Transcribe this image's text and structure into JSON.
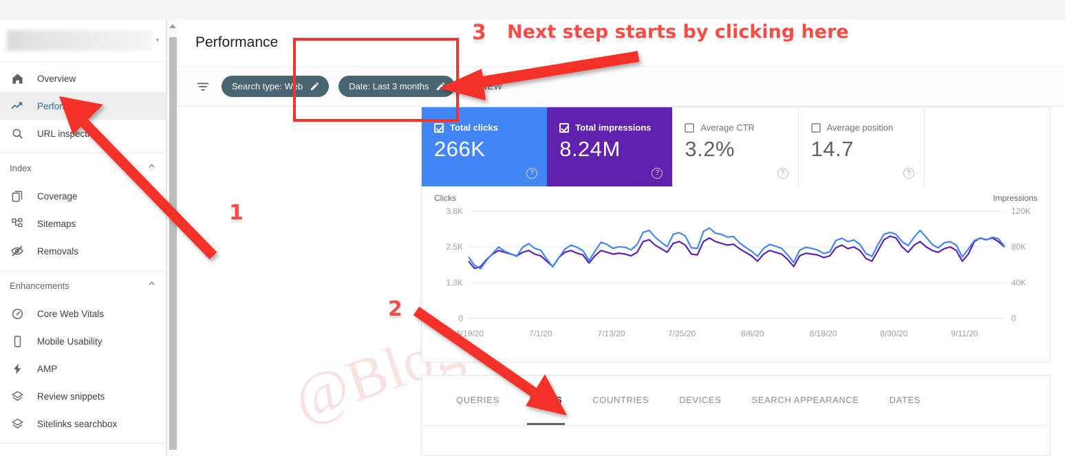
{
  "window": {
    "title": "Performance"
  },
  "sidebar": {
    "property_selector": {
      "name": "property-selector",
      "blurred": true,
      "caret": "▾"
    },
    "items": [
      {
        "label": "Overview",
        "icon": "home-icon",
        "active": false
      },
      {
        "label": "Performance",
        "icon": "trending-up-icon",
        "active": true
      },
      {
        "label": "URL inspection",
        "icon": "search-icon",
        "active": false
      }
    ],
    "groups": [
      {
        "title": "Index",
        "collapse_icon": "chevron-up-icon",
        "items": [
          {
            "label": "Coverage",
            "icon": "pages-icon"
          },
          {
            "label": "Sitemaps",
            "icon": "sitemap-icon"
          },
          {
            "label": "Removals",
            "icon": "eye-off-icon"
          }
        ]
      },
      {
        "title": "Enhancements",
        "collapse_icon": "chevron-up-icon",
        "items": [
          {
            "label": "Core Web Vitals",
            "icon": "speedometer-icon"
          },
          {
            "label": "Mobile Usability",
            "icon": "mobile-icon"
          },
          {
            "label": "AMP",
            "icon": "bolt-icon"
          },
          {
            "label": "Review snippets",
            "icon": "layers-icon"
          },
          {
            "label": "Sitelinks searchbox",
            "icon": "layers-icon"
          }
        ]
      }
    ]
  },
  "header": {
    "title": "Performance"
  },
  "filters": {
    "filter_icon": "filter-icon",
    "chips": [
      {
        "label": "Search type: Web",
        "edit_icon": "pencil-icon"
      },
      {
        "label": "Date: Last 3 months",
        "edit_icon": "pencil-icon"
      }
    ],
    "new_button": {
      "label": "NEW",
      "icon": "plus-icon"
    }
  },
  "metrics": [
    {
      "label": "Total clicks",
      "value": "266K",
      "checked": true,
      "style": "blue",
      "help": "?"
    },
    {
      "label": "Total impressions",
      "value": "8.24M",
      "checked": true,
      "style": "purple",
      "help": "?"
    },
    {
      "label": "Average CTR",
      "value": "3.2%",
      "checked": false,
      "style": "light",
      "help": "?"
    },
    {
      "label": "Average position",
      "value": "14.7",
      "checked": false,
      "style": "light",
      "help": "?"
    }
  ],
  "tabs": [
    {
      "label": "QUERIES",
      "active": false
    },
    {
      "label": "PAGES",
      "active": true
    },
    {
      "label": "COUNTRIES",
      "active": false
    },
    {
      "label": "DEVICES",
      "active": false
    },
    {
      "label": "SEARCH APPEARANCE",
      "active": false
    },
    {
      "label": "DATES",
      "active": false
    }
  ],
  "watermark": {
    "text": "@BlogSuccessJournal"
  },
  "annotations": {
    "callout_text": "Next step starts by clicking here",
    "numbers": [
      "1",
      "2",
      "3"
    ],
    "highlight_color": "#f5322b",
    "arrow_color": "#f5322b"
  },
  "chart_data": {
    "type": "line",
    "title": "",
    "ylabel_left": "Clicks",
    "ylabel_right": "Impressions",
    "grid": true,
    "legend_position": "none",
    "yticks_left": [
      "0",
      "1.3K",
      "2.5K",
      "3.8K"
    ],
    "yticks_right": [
      "0",
      "40K",
      "80K",
      "120K"
    ],
    "ylim_left": [
      0,
      3800
    ],
    "ylim_right": [
      0,
      120000
    ],
    "xticks": [
      "6/19/20",
      "7/1/20",
      "7/13/20",
      "7/25/20",
      "8/6/20",
      "8/18/20",
      "8/30/20",
      "9/11/20"
    ],
    "series": [
      {
        "name": "Clicks",
        "color": "#4285f4",
        "values": [
          2180,
          1880,
          1760,
          2060,
          2300,
          2530,
          2380,
          2290,
          2200,
          2520,
          2650,
          2480,
          2420,
          2100,
          1830,
          2150,
          2450,
          2600,
          2520,
          2400,
          2050,
          2380,
          2700,
          2620,
          2480,
          2540,
          2520,
          2430,
          2620,
          3050,
          3120,
          2880,
          2700,
          2540,
          2980,
          3040,
          2920,
          2500,
          2480,
          3080,
          3200,
          3020,
          2980,
          2880,
          2900,
          2680,
          2520,
          2380,
          2200,
          2480,
          2620,
          2560,
          2480,
          2250,
          1980,
          2420,
          2520,
          2480,
          2420,
          2300,
          2360,
          2760,
          2840,
          2720,
          2780,
          2620,
          2300,
          2200,
          2620,
          2980,
          3050,
          2980,
          2720,
          2580,
          2880,
          3120,
          2880,
          2620,
          2500,
          2680,
          2720,
          2600,
          2180,
          2460,
          2760,
          2840,
          2780,
          2880,
          2820,
          2560
        ]
      },
      {
        "name": "Impressions",
        "color": "#5b21b6",
        "values": [
          64000,
          56000,
          58000,
          66000,
          72000,
          76000,
          74000,
          72000,
          70000,
          74000,
          76000,
          72000,
          70000,
          64000,
          58000,
          68000,
          74000,
          76000,
          73000,
          71000,
          62000,
          70000,
          76000,
          74000,
          72000,
          73000,
          72000,
          70000,
          74000,
          86000,
          88000,
          82000,
          78000,
          74000,
          84000,
          86000,
          82000,
          72000,
          71000,
          86000,
          90000,
          86000,
          84000,
          82000,
          83000,
          78000,
          74000,
          70000,
          64000,
          72000,
          76000,
          74000,
          72000,
          66000,
          58000,
          70000,
          73000,
          72000,
          71000,
          68000,
          70000,
          79000,
          82000,
          78000,
          80000,
          76000,
          67000,
          64000,
          76000,
          88000,
          92000,
          90000,
          80000,
          74000,
          82000,
          86000,
          80000,
          76000,
          74000,
          78000,
          80000,
          76000,
          64000,
          72000,
          86000,
          90000,
          88000,
          90000,
          86000,
          80000
        ]
      }
    ]
  }
}
